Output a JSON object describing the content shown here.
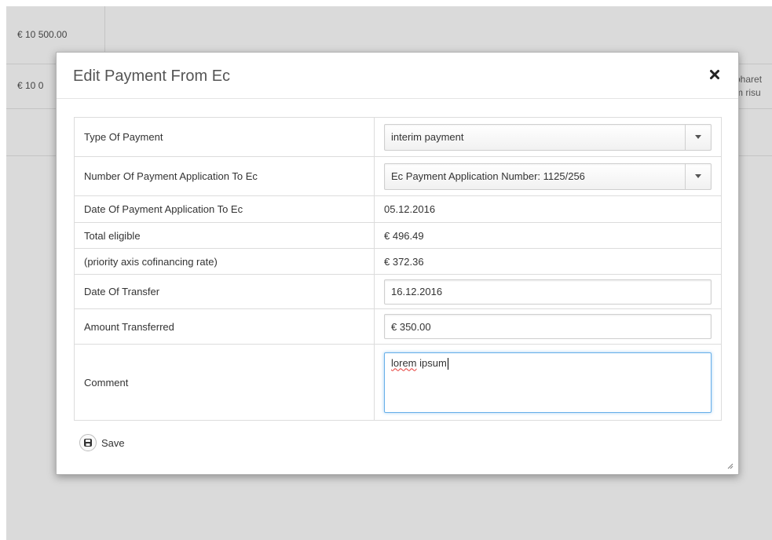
{
  "background": {
    "row1_amount": "€ 10 500.00",
    "row2_amount": "€ 10 0",
    "row2_right_line1": "pharet",
    "row2_right_line2": "m risu"
  },
  "modal": {
    "title": "Edit Payment From Ec",
    "fields": {
      "type_of_payment": {
        "label": "Type Of Payment",
        "value": "interim payment"
      },
      "payment_application": {
        "label": "Number Of Payment Application To Ec",
        "value": "Ec Payment Application Number: 1125/256"
      },
      "date_application": {
        "label": "Date Of Payment Application To Ec",
        "value": "05.12.2016"
      },
      "total_eligible": {
        "label": "Total eligible",
        "value": "€ 496.49"
      },
      "cofinancing": {
        "label": "(priority axis cofinancing rate)",
        "value": "€ 372.36"
      },
      "date_transfer": {
        "label": "Date Of Transfer",
        "value": "16.12.2016"
      },
      "amount_transferred": {
        "label": "Amount Transferred",
        "value": "€ 350.00"
      },
      "comment": {
        "label": "Comment",
        "word1": "lorem",
        "word2": " ipsum"
      }
    },
    "save_label": "Save"
  },
  "icons": {
    "close": "close-icon",
    "save": "floppy-disk-icon",
    "dropdown": "caret-down-icon",
    "resize": "resize-grip-icon"
  },
  "colors": {
    "overlay": "#dadada",
    "focus": "#66afe9"
  }
}
